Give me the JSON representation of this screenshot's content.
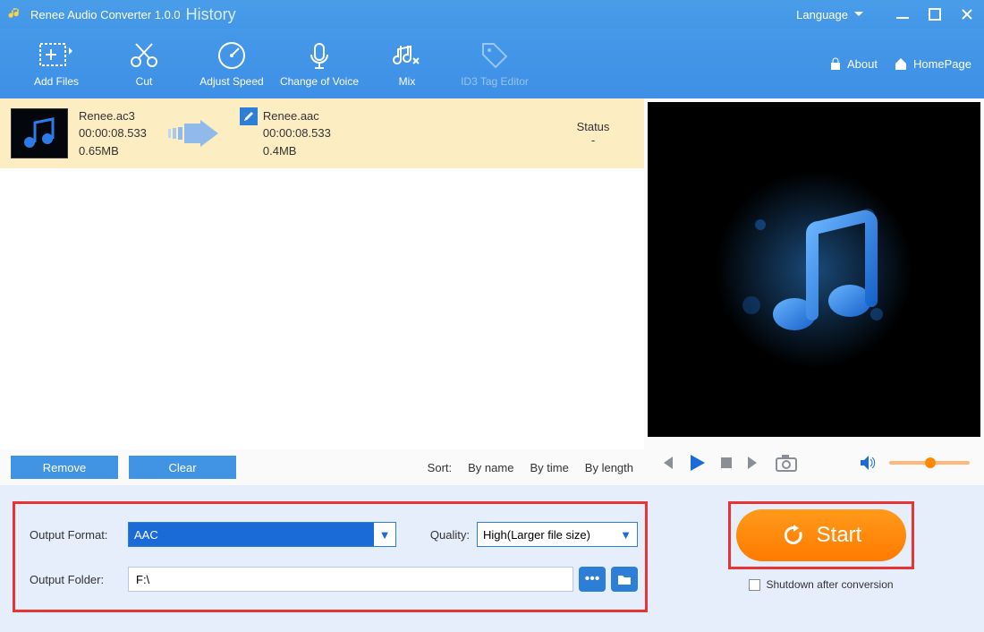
{
  "titlebar": {
    "app": "Renee Audio Converter 1.0.0",
    "history": "History",
    "language": "Language"
  },
  "toolbar": {
    "items": [
      {
        "label": "Add Files"
      },
      {
        "label": "Cut"
      },
      {
        "label": "Adjust Speed"
      },
      {
        "label": "Change of Voice"
      },
      {
        "label": "Mix"
      },
      {
        "label": "ID3 Tag Editor"
      }
    ],
    "about": "About",
    "home": "HomePage"
  },
  "file": {
    "src": {
      "name": "Renee.ac3",
      "dur": "00:00:08.533",
      "size": "0.65MB"
    },
    "dst": {
      "name": "Renee.aac",
      "dur": "00:00:08.533",
      "size": "0.4MB"
    },
    "status_hdr": "Status",
    "status_val": "-"
  },
  "listfooter": {
    "remove": "Remove",
    "clear": "Clear",
    "sort": "Sort:",
    "byname": "By name",
    "bytime": "By time",
    "bylen": "By length"
  },
  "settings": {
    "out_format_lbl": "Output Format:",
    "out_format_val": "AAC",
    "quality_lbl": "Quality:",
    "quality_val": "High(Larger file size)",
    "out_folder_lbl": "Output Folder:",
    "out_folder_val": "F:\\"
  },
  "start": {
    "label": "Start",
    "shutdown": "Shutdown after conversion"
  }
}
